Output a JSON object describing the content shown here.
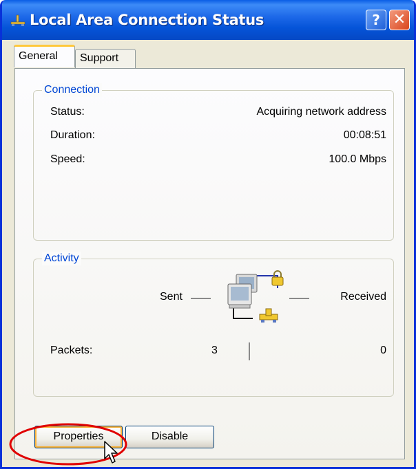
{
  "window": {
    "title": "Local Area Connection Status",
    "help_glyph": "?",
    "close_glyph": "✕",
    "title_icon": "network-connection-icon"
  },
  "tabs": [
    {
      "label": "General",
      "selected": true
    },
    {
      "label": "Support",
      "selected": false
    }
  ],
  "connection": {
    "group_label": "Connection",
    "rows": [
      {
        "label": "Status:",
        "value": "Acquiring network address"
      },
      {
        "label": "Duration:",
        "value": "00:08:51"
      },
      {
        "label": "Speed:",
        "value": "100.0 Mbps"
      }
    ]
  },
  "activity": {
    "group_label": "Activity",
    "sent_label": "Sent",
    "received_label": "Received",
    "packets_label": "Packets:",
    "packets_sent": "3",
    "packets_received": "0",
    "icon": "network-computers-lock-icon"
  },
  "buttons": {
    "properties": "Properties",
    "disable": "Disable"
  },
  "colors": {
    "titlebar": "#0554d8",
    "group_label": "#0046d5",
    "annotation": "#e00000"
  }
}
